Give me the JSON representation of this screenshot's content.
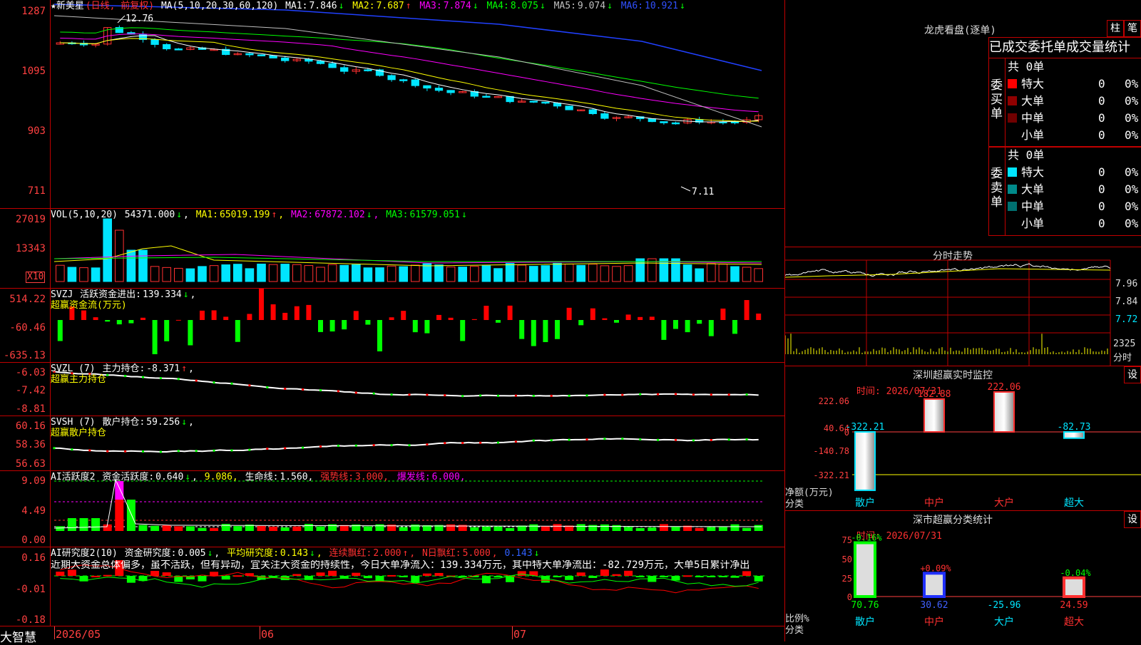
{
  "colors": {
    "up": "#ff3030",
    "down": "#00e5ff",
    "grid": "#c00000",
    "ma1": "#ffffff",
    "ma2": "#ffff00",
    "ma3": "#ff00ff",
    "ma4": "#00ff00",
    "ma5": "#c0c0c0",
    "ma6": "#0000ff",
    "green": "#00ff00",
    "red": "#ff0000"
  },
  "main": {
    "stock_name": "★新美星",
    "period": "(日线, 前复权)",
    "ma_param": "MA(5,10,20,30,60,120)",
    "ma": [
      {
        "label": "MA1:",
        "value": "7.846",
        "arrow": "↓"
      },
      {
        "label": "MA2:",
        "value": "7.687",
        "arrow": "↑"
      },
      {
        "label": "MA3:",
        "value": "7.874",
        "arrow": "↓"
      },
      {
        "label": "MA4:",
        "value": "8.075",
        "arrow": "↓"
      },
      {
        "label": "MA5:",
        "value": "9.074",
        "arrow": "↓"
      },
      {
        "label": "MA6:",
        "value": "10.921",
        "arrow": "↓"
      }
    ],
    "yaxis": [
      "1287",
      "1095",
      "903",
      "711"
    ],
    "high_label": "12.76",
    "low_label": "7.11"
  },
  "vol": {
    "title": "VOL(5,10,20)",
    "value": "54371.000",
    "arrow": "↓",
    "ma": [
      {
        "label": "MA1:",
        "value": "65019.199",
        "arrow": "↑"
      },
      {
        "label": "MA2:",
        "value": "67872.102",
        "arrow": "↓"
      },
      {
        "label": "MA3:",
        "value": "61579.051",
        "arrow": "↓"
      }
    ],
    "yaxis": [
      "27019",
      "13343"
    ],
    "unit": "X10"
  },
  "svzj": {
    "title": "SVZJ",
    "label": "活跃资金进出:",
    "value": "139.334",
    "arrow": "↓",
    "subtitle": "超赢资金流(万元)",
    "yaxis": [
      "514.22",
      "-60.46",
      "-635.13"
    ]
  },
  "svzl": {
    "title": "SVZL (7)",
    "label": "主力持仓:",
    "value": "-8.371",
    "arrow": "↑",
    "suffix": ",",
    "subtitle": "超赢主力持仓",
    "yaxis": [
      "-6.03",
      "-7.42",
      "-8.81"
    ]
  },
  "svsh": {
    "title": "SVSH (7)",
    "label": "散户持仓:",
    "value": "59.256",
    "arrow": "↓",
    "suffix": ",",
    "subtitle": "超赢散户持仓",
    "yaxis": [
      "60.16",
      "58.36",
      "56.63"
    ]
  },
  "ai1": {
    "title": "AI活跃度2",
    "label": "资金活跃度:",
    "value": "0.640",
    "arrow": "↓",
    "v2": "9.086,",
    "life_label": "生命线:",
    "life": "1.560,",
    "strong_label": "强势线:",
    "strong": "3.000,",
    "burst_label": "爆发线:",
    "burst": "6.000,",
    "yaxis": [
      "9.09",
      "4.49",
      "0.00"
    ]
  },
  "ai2": {
    "title": "AI研究度2(10)",
    "label": "资金研究度:",
    "value": "0.005",
    "arrow": "↓",
    "avg_label": "平均研究度:",
    "avg": "0.143",
    "avg_arrow": "↓",
    "cont_label": "连续飘红:",
    "cont": "2.000",
    "cont_arrow": "↑",
    "nday_label": "N日飘红:",
    "nday": "5.000",
    "nday_v": "0.143",
    "nday_arrow": "↓",
    "comment": "近期大资金总体偏多，虽不活跃，但有异动，宜关注大资金的持续性，今日大单净流入：139.334万元，其中特大单净流出：-82.729万元，大单5日累计净出",
    "yaxis": [
      "0.16",
      "-0.01",
      "-0.18"
    ]
  },
  "xaxis": {
    "labels": [
      "2026/05",
      "06",
      "07"
    ],
    "brand": "大智慧"
  },
  "lhb": {
    "title": "龙虎看盘(逐单)",
    "btn1": "柱",
    "btn2": "笔",
    "header": "已成交委托单成交量统计",
    "buy": {
      "side": "委买单",
      "total": "共 0单",
      "rows": [
        {
          "name": "特大",
          "count": "0",
          "pct": "0%"
        },
        {
          "name": "大单",
          "count": "0",
          "pct": "0%"
        },
        {
          "name": "中单",
          "count": "0",
          "pct": "0%"
        },
        {
          "name": "小单",
          "count": "0",
          "pct": "0%"
        }
      ]
    },
    "sell": {
      "side": "委卖单",
      "total": "共 0单",
      "rows": [
        {
          "name": "特大",
          "count": "0",
          "pct": "0%"
        },
        {
          "name": "大单",
          "count": "0",
          "pct": "0%"
        },
        {
          "name": "中单",
          "count": "0",
          "pct": "0%"
        },
        {
          "name": "小单",
          "count": "0",
          "pct": "0%"
        }
      ]
    }
  },
  "intraday": {
    "title": "分时走势",
    "yaxis": [
      "7.96",
      "7.84",
      "7.72"
    ],
    "vol_label": "2325",
    "vol_unit": "分时"
  },
  "sz_monitor": {
    "title": "深圳超赢实时监控",
    "btn": "设",
    "time": "时间: 2026/07/31",
    "yaxis": [
      "222.06",
      "40.64",
      "0",
      "-140.78",
      "-322.21"
    ],
    "net_label": "净额(万元)",
    "cat_label": "分类",
    "bars": [
      {
        "name": "散户",
        "value": -322.21,
        "label": "-322.21"
      },
      {
        "name": "中户",
        "value": 182.88,
        "label": "182.88"
      },
      {
        "name": "大户",
        "value": 222.06,
        "label": "222.06"
      },
      {
        "name": "超大",
        "value": -82.73,
        "label": "-82.73"
      }
    ]
  },
  "sz_category": {
    "title": "深市超赢分类统计",
    "btn": "设",
    "time": "时间: 2026/07/31",
    "yaxis": [
      "75",
      "50",
      "25",
      "0"
    ],
    "ratio_label": "比例%",
    "cat_label": "分类",
    "bars": [
      {
        "name": "散户",
        "value": 70.76,
        "label": "70.76",
        "change": "-0.16%"
      },
      {
        "name": "中户",
        "value": 30.62,
        "label": "30.62",
        "change": "+0.09%"
      },
      {
        "name": "大户",
        "value": -25.96,
        "label": "-25.96",
        "change": ""
      },
      {
        "name": "超大",
        "value": 24.59,
        "label": "24.59",
        "change": "-0.04%"
      }
    ]
  }
}
